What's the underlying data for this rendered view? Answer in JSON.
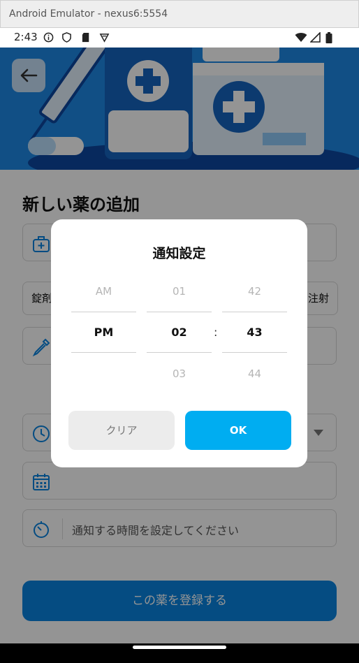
{
  "emulator": {
    "title": "Android Emulator - nexus6:5554"
  },
  "status_bar": {
    "time": "2:43"
  },
  "page": {
    "title": "新しい薬の追加",
    "chips": {
      "left": "錠剤",
      "right": "注射"
    },
    "reminder_placeholder": "通知する時間を設定してください",
    "register_button": "この薬を登録する"
  },
  "dialog": {
    "title": "通知設定",
    "ampm": {
      "above": "AM",
      "selected": "PM",
      "below": ""
    },
    "hours": {
      "above": "01",
      "selected": "02",
      "below": "03"
    },
    "minutes": {
      "above": "42",
      "selected": "43",
      "below": "44"
    },
    "separator": ":",
    "clear_label": "クリア",
    "ok_label": "OK"
  },
  "colors": {
    "primary": "#0a84e0",
    "ok_button": "#00adf1",
    "hero_bg": "#1e88e5"
  }
}
